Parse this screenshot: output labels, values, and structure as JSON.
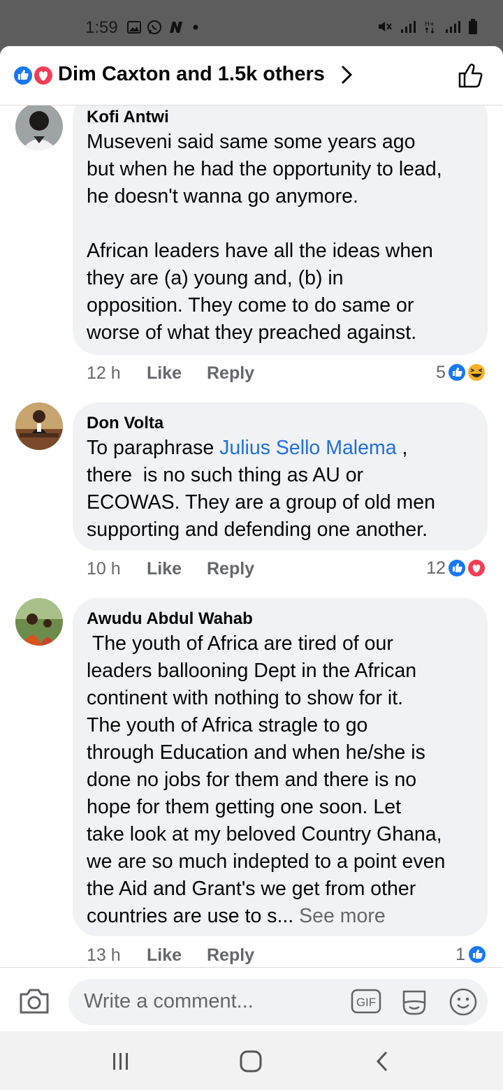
{
  "status_bar": {
    "time": "1:59",
    "left_icons": [
      "gallery-icon",
      "whatsapp-icon",
      "n-app-icon",
      "dot-icon"
    ],
    "right_icons": [
      "mute-icon",
      "signal-icon",
      "hplus-icon",
      "signal2-icon",
      "battery-icon"
    ]
  },
  "header": {
    "title": "Dim Caxton and 1.5k others",
    "reactions": [
      "like",
      "love"
    ]
  },
  "comments": [
    {
      "author": "Kofi Antwi",
      "lines": [
        "Museveni said same some years ago",
        "but when he had the opportunity to lead,",
        "he doesn't wanna go anymore.",
        "",
        "African leaders have all the ideas when",
        "they are (a) young and, (b) in",
        "opposition. They come to do same or",
        "worse of what they preached against."
      ],
      "time": "12 h",
      "like_label": "Like",
      "reply_label": "Reply",
      "reaction_count": "5",
      "reactions": [
        "like",
        "haha"
      ]
    },
    {
      "author": "Don Volta",
      "line1_before": "To paraphrase ",
      "mention": "Julius Sello Malema",
      "line1_after": " ,",
      "lines": [
        "there  is no such thing as AU or",
        "ECOWAS. They are a group of old men",
        "supporting and defending one another."
      ],
      "time": "10 h",
      "like_label": "Like",
      "reply_label": "Reply",
      "reaction_count": "12",
      "reactions": [
        "like",
        "love"
      ]
    },
    {
      "author": "Awudu Abdul Wahab",
      "lines": [
        " The youth of Africa are tired of our",
        "leaders ballooning Dept in the African",
        "continent with nothing to show for it.",
        "The youth of Africa stragle to go",
        "through Education and when he/she is",
        "done no jobs for them and there is no",
        "hope for them getting one soon. Let",
        "take look at my beloved Country Ghana,",
        "we are so much indepted to a point even",
        "the Aid and Grant's we get from other"
      ],
      "last_line": "countries are use to s... ",
      "see_more": "See more",
      "time": "13 h",
      "like_label": "Like",
      "reply_label": "Reply",
      "reaction_count": "1",
      "reactions": [
        "like"
      ]
    }
  ],
  "composer": {
    "placeholder": "Write a comment...",
    "gif_label": "GIF"
  },
  "colors": {
    "like_blue": "#1877f2",
    "love_red": "#f33e58",
    "haha_yellow": "#f7b125",
    "mention_blue": "#216fdb",
    "bubble_bg": "#f0f2f5",
    "meta_gray": "#65676b"
  }
}
